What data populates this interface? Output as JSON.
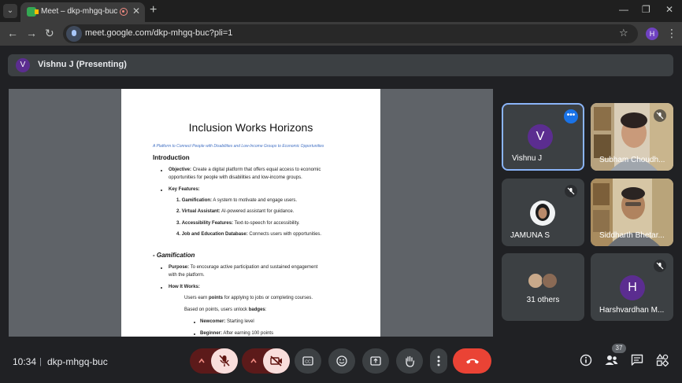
{
  "browser": {
    "tab_title": "Meet – dkp-mhgq-buc",
    "tab_close_glyph": "✕",
    "new_tab_glyph": "+",
    "menu_glyph": "⌄",
    "url": "meet.google.com/dkp-mhgq-buc?pli=1",
    "profile_initial": "H",
    "back_glyph": "←",
    "forward_glyph": "→",
    "reload_glyph": "↻",
    "star_glyph": "☆",
    "kebab_glyph": "⋮",
    "minimize_glyph": "—",
    "restore_glyph": "❐",
    "close_glyph": "✕"
  },
  "presenting_bar": {
    "avatar_initial": "V",
    "label": "Vishnu J (Presenting)"
  },
  "document": {
    "title": "Inclusion Works Horizons",
    "subtitle": "A Platform to Connect People with Disabilities and Low-Income Groups to Economic Opportunities",
    "intro_heading": "Introduction",
    "objective_label": "Objective:",
    "objective_line1": "Create a digital platform that offers equal access to economic",
    "objective_line2": "opportunities for people with disabilities and low-income groups.",
    "key_features_label": "Key Features:",
    "features": [
      {
        "num": "1.",
        "label": "Gamification:",
        "text": "A system to motivate and engage users."
      },
      {
        "num": "2.",
        "label": "Virtual Assistant:",
        "text": "AI-powered assistant for guidance."
      },
      {
        "num": "3.",
        "label": "Accessibility Features:",
        "text": "Text-to-speech for accessibility."
      },
      {
        "num": "4.",
        "label": "Job and Education Database:",
        "text": "Connects users with opportunities."
      }
    ],
    "gamification_heading": "- Gamification",
    "purpose_label": "Purpose:",
    "purpose_line1": "To encourage active participation and sustained engagement",
    "purpose_line2": "with the platform.",
    "how_label": "How It Works:",
    "how_item1_pre": "Users earn",
    "how_item1_bold": "points",
    "how_item1_post": "for applying to jobs or completing courses.",
    "how_item2_pre": "Based on points, users unlock",
    "how_item2_bold": "badges",
    "how_item2_post": ":",
    "levels": [
      {
        "label": "Newcomer:",
        "text": "Starting level"
      },
      {
        "label": "Beginner:",
        "text": "After earning 100 points"
      }
    ]
  },
  "participants": [
    {
      "name": "Vishnu J",
      "initial": "V",
      "avatar_color": "#5b2d90",
      "muted": false,
      "active": true
    },
    {
      "name": "Subham Choudh...",
      "muted": true,
      "has_video": true
    },
    {
      "name": "JAMUNA S",
      "muted": true
    },
    {
      "name": "Siddharth Bhetar...",
      "has_video": true
    },
    {
      "name": "31 others"
    },
    {
      "name": "Harshvardhan M...",
      "initial": "H",
      "avatar_color": "#5b2d90",
      "muted": true
    }
  ],
  "controls": {
    "time": "10:34",
    "separator": "|",
    "meeting_code": "dkp-mhgq-buc",
    "people_count": "37"
  },
  "colors": {
    "hangup": "#ea4335",
    "active_border": "#8ab4f8",
    "mic_off_bg": "#f9dedc"
  }
}
